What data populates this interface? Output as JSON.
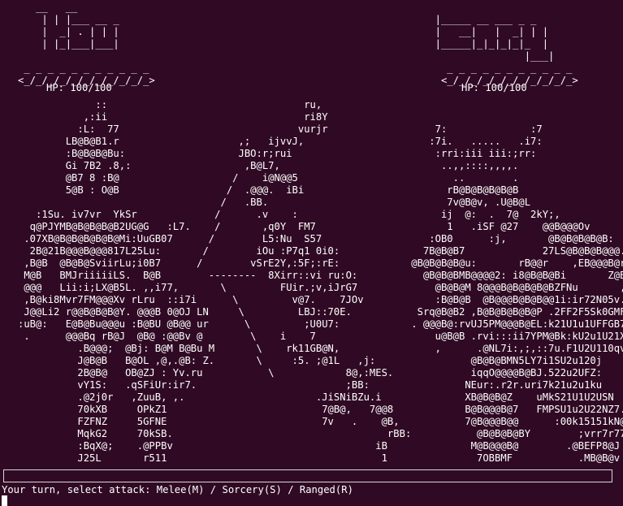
{
  "player": {
    "hp_label": "HP: 100/100"
  },
  "enemy": {
    "hp_label": "HP: 100/100"
  },
  "battle_art": "      __   __\n       | | |___ __ _                                                     |_____ __ ___ _ _\n       |  _| . | | |                                                     |   __|   |  _| | |\n       | |_|___|___|                                                     |_____|_|_|_|_|_  |\n                                                                                        |___|\n    _ _ _ _ _ _ _ _ _ _ _                                                  _ _ _ _ _ _ _ _ _ _ _\n   <_/_/_/_/_/_/_/_/_/_/_>                                                <_/_/_/_/_/_/_/_/_/_/_>\n\n                ::                                 ru,\n              ,:ii                                 ri8Y\n             :L:  77                              vurjr                  7:              :7\n           LB@B@B1.r                    ,;   ijvvJ,                     :7i.   .....   .i7:\n           :B@B@B@Bu:                   JBO:r;rui                        :rri:iii iii:;rr:\n           Gi 7B2 .8,:                   ,B@L7,                           ..,,::::,,,,.\n           @B7 8 :B@                   /    i@N@@5                          ..        .\n           5@B : O@B                  /  .@@@.  iBi                        rB@B@B@B@B@B\n                                     /   .BB.                              7v@B@v, .U@B@L\n      :1Su. iv7vr  YkSr             /      .v    :                        ij  @:  .  7@  2kY;,\n     q@PJYMB@B@B@B@B2UG@G   :L7.    /       ,q0Y  FM7                      1   .iSF @27    @@B@@@Ov\n    .07XB@B@B@B@B@B@Mi:UuGB07      /        L5:Nu  S57                  :OB0      :j,       @B@B@B@B@B:\n     2B@21B@@@B@@@817L25Lu:       /        iOu :P7q1 0i0:              7B@B@B7             27LS@B@B@B@@@.\n    ,B@B  @B@B@SviirLu;i0B7      /        vSrE2Y,:5F;:rE:            @B@B@B@B@u:       rB@@r    ,EB@@@B@r\n    M@B   BMJriiiiiLS.  B@B        --------  8Xirr::vi ru:O:           @B@B@BMB@@@@2: i8@B@B@Bi       Z@B@B@\n    @@@   Lii:i;LX@B5L. ,,i77,       \\         FUir.;v,iJrG7             @B@B@M 8@@@B@B@B@B@BZFNu       ,GO1\n    ,B@ki8Mvr7FM@@@Xv rLru  ::i7i      \\         v@7.    7JOv            :B@B@B  @B@@@B@B@B@@1i:ir72N05v.\n    J@@Li2 r@@B@B@B@Y. @@@B 0@OJ LN     \\         LBJ::70E.           Srq@B@B2 ,B@B@B@B@B@P .2FF2F5Sk0GMF.\n   :uB@:   E@B@Bu@@@u :B@BU @B@@ ur      \\         ;U0U7:            . @@@B@:rvUJ5PM@@@B@EL:k21U1u1UFFGB7\n    .      @@@Bq rB@J  @B@ :@@Bv @        \\    i    7                    u@B@B .rvi:::ii7YPM@Bk:kU2u1U21XGBB7\n             .B@@@;  @Bj: B@M B@Bu M       \\    rk11GB@N,                ,      .@NL7i:,;,::7u.F1U2U110qv:,,\n             J@B@B   B@OL ,@,.@B: Z.       \\     :5. ;@1L   ,j:                @B@B@BMN5LY7i1SU2u120j\n             2B@B@   OB@ZJ : Yv.ru           \\            8@,:MES.             iqqO@@@@B@BJ.522u2UFZ:\n             vY1S:   .qSFiUr:ir7.                         ;BB:                NEur:.r2r.uri7k21u2u1ku\n             .@2j0r   ,ZuuB, ,.                      .JiSNiBZu.i              XB@B@B@Z    uMkS21U1U2USN\n             70kXB     OPkZ1                          7@B@,   7@@8            B@B@@@B@7   FMPSU1u2U22NZ7.\n             FZFNZ     5GFNE                          7v   .    @B,           7@B@@@B@@      :00k15151kN@Bv\n             MqkG2     70kSB.                                    rBB:           @B@B@B@BY        ;vrr7r77L.\n             :BqX@;    .@PPBv                                  iB              M@B@@@B@        .@BEFP8@J\n             J25L       r511                                    1               7OBBMF           .MB@B@v",
  "prompt": {
    "text": "Your turn, select attack: Melee(M) / Sorcery(S) / Ranged(R)"
  },
  "colors": {
    "background": "#300a24",
    "text": "#ffffff"
  }
}
